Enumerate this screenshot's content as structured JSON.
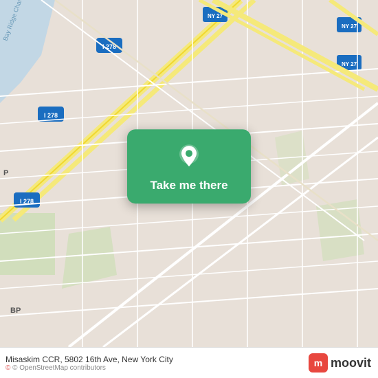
{
  "map": {
    "backgroundColor": "#e8e0d8",
    "roadColor": "#ffffff",
    "highwayColor": "#f5e97a",
    "waterColor": "#a8c8e8",
    "greenColor": "#c8e0b0"
  },
  "card": {
    "label": "Take me there",
    "backgroundColor": "#3aaa6e"
  },
  "attribution": {
    "text": "© OpenStreetMap contributors"
  },
  "address": {
    "text": "Misaskim CCR, 5802 16th Ave, New York City"
  },
  "brand": {
    "name": "moovit",
    "iconLetter": "m"
  }
}
